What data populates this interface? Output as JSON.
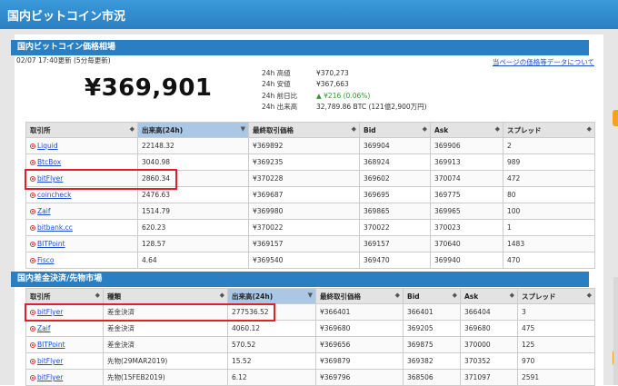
{
  "header": {
    "title": "国内ビットコイン市況"
  },
  "section1": {
    "title": "国内ビットコイン価格相場"
  },
  "update_text": "02/07 17:40更新 (5分毎更新)",
  "price_link": "当ページの価格等データについて",
  "price": "¥369,901",
  "stats": [
    {
      "label": "24h 高値",
      "value": "¥370,273"
    },
    {
      "label": "24h 安値",
      "value": "¥367,663"
    },
    {
      "label": "24h 前日比",
      "value": "▲ ¥216 (0.06%)"
    },
    {
      "label": "24h 出来高",
      "value": "32,789.86 BTC (121億2,900万円)"
    }
  ],
  "spot": {
    "headers": [
      "取引所",
      "出来高(24h)",
      "最終取引価格",
      "Bid",
      "Ask",
      "スプレッド"
    ],
    "rows": [
      [
        "Liquid",
        "22148.32",
        "¥369892",
        "369904",
        "369906",
        "2"
      ],
      [
        "BtcBox",
        "3040.98",
        "¥369235",
        "368924",
        "369913",
        "989"
      ],
      [
        "bitFlyer",
        "2860.34",
        "¥370228",
        "369602",
        "370074",
        "472"
      ],
      [
        "coincheck",
        "2476.63",
        "¥369687",
        "369695",
        "369775",
        "80"
      ],
      [
        "Zaif",
        "1514.79",
        "¥369980",
        "369865",
        "369965",
        "100"
      ],
      [
        "bitbank.cc",
        "620.23",
        "¥370022",
        "370022",
        "370023",
        "1"
      ],
      [
        "BITPoint",
        "128.57",
        "¥369157",
        "369157",
        "370640",
        "1483"
      ],
      [
        "Fisco",
        "4.64",
        "¥369540",
        "369470",
        "369940",
        "470"
      ]
    ]
  },
  "section2": {
    "title": "国内差金決済/先物市場"
  },
  "futures": {
    "headers": [
      "取引所",
      "種類",
      "出来高(24h)",
      "最終取引価格",
      "Bid",
      "Ask",
      "スプレッド"
    ],
    "rows": [
      [
        "bitFlyer",
        "差金決済",
        "277536.52",
        "¥366401",
        "366401",
        "366404",
        "3"
      ],
      [
        "Zaif",
        "差金決済",
        "4060.12",
        "¥369680",
        "369205",
        "369680",
        "475"
      ],
      [
        "BITPoint",
        "差金決済",
        "570.52",
        "¥369656",
        "369875",
        "370000",
        "125"
      ],
      [
        "bitFlyer",
        "先物(29MAR2019)",
        "15.52",
        "¥369879",
        "369382",
        "370352",
        "970"
      ],
      [
        "bitFlyer",
        "先物(15FEB2019)",
        "6.12",
        "¥369796",
        "368506",
        "371097",
        "2591"
      ]
    ]
  },
  "colors": {
    "header": "#2a7fc2",
    "sorted_column": "#aac7e6",
    "highlight_box": "#e0202a",
    "up": "#2c9a2c"
  }
}
